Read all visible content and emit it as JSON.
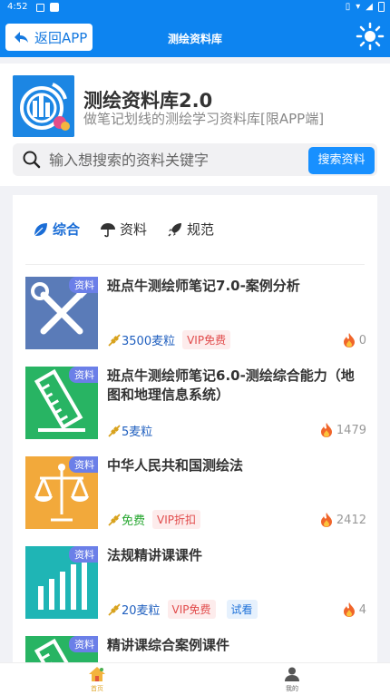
{
  "statusbar": {
    "time": "4:52"
  },
  "appbar": {
    "back_label": "返回APP",
    "title": "测绘资料库"
  },
  "brand": {
    "title": "测绘资料库2.0",
    "subtitle": "做笔记划线的测绘学习资料库[限APP端]"
  },
  "search": {
    "placeholder": "输入想搜索的资料关键字",
    "button": "搜索资料"
  },
  "tabs": [
    {
      "label": "综合",
      "icon": "leaf-icon",
      "active": true
    },
    {
      "label": "资料",
      "icon": "umbrella-icon",
      "active": false
    },
    {
      "label": "规范",
      "icon": "rocket-icon",
      "active": false
    }
  ],
  "items": [
    {
      "tag": "资料",
      "title": "班点牛测绘师笔记7.0-案例分析",
      "price": "3500麦粒",
      "badge": "VIP免费",
      "views": "0",
      "thumb_color": "#5a7bb8",
      "icon": "tools-icon"
    },
    {
      "tag": "资料",
      "title": "班点牛测绘师笔记6.0-测绘综合能力（地图和地理信息系统）",
      "price": "5麦粒",
      "badge": "",
      "views": "1479",
      "thumb_color": "#28b463",
      "icon": "ruler-icon"
    },
    {
      "tag": "资料",
      "title": "中华人民共和国测绘法",
      "price": "免费",
      "badge": "VIP折扣",
      "views": "2412",
      "thumb_color": "#f2a93b",
      "icon": "scales-icon"
    },
    {
      "tag": "资料",
      "title": "法规精讲课课件",
      "price": "20麦粒",
      "badge": "VIP免费",
      "try": "试看",
      "views": "4",
      "thumb_color": "#1fb5b5",
      "icon": "bars-icon"
    },
    {
      "tag": "资料",
      "title": "精讲课综合案例课件",
      "thumb_color": "#28b463",
      "icon": "ruler-icon"
    }
  ],
  "bottom_nav": [
    {
      "label": "首页",
      "icon": "home-icon",
      "active": true
    },
    {
      "label": "我的",
      "icon": "user-icon",
      "active": false
    }
  ]
}
